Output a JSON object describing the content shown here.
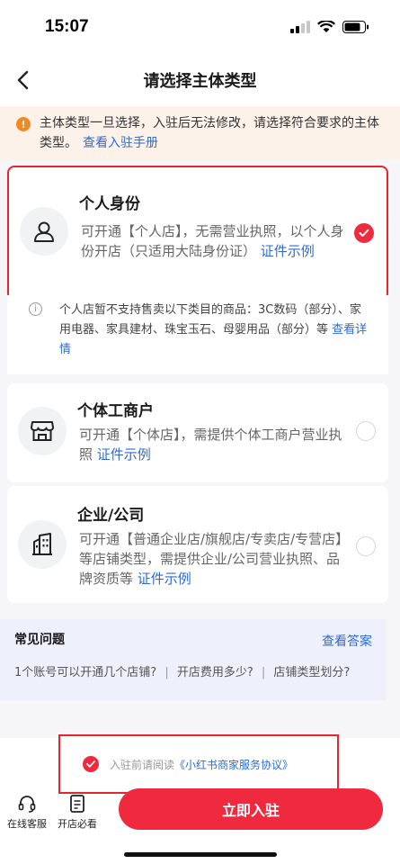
{
  "status_bar": {
    "time": "15:07"
  },
  "navbar": {
    "title": "请选择主体类型"
  },
  "notice": {
    "text": "主体类型一旦选择，入驻后无法修改，请选择符合要求的主体类型。",
    "link": "查看入驻手册"
  },
  "cards": [
    {
      "title": "个人身份",
      "desc": "可开通【个人店】，无需营业执照，以个人身份开店（只适用大陆身份证）",
      "link": "证件示例",
      "selected": true,
      "icon": "person-icon"
    },
    {
      "title": "个体工商户",
      "desc": "可开通【个体店】，需提供个体工商户营业执照",
      "link": "证件示例",
      "selected": false,
      "icon": "storefront-icon"
    },
    {
      "title": "企业/公司",
      "desc": "可开通【普通企业店/旗舰店/专卖店/专营店】等店铺类型，需提供企业/公司营业执照、品牌资质等",
      "link": "证件示例",
      "selected": false,
      "icon": "building-icon"
    }
  ],
  "personal_info": {
    "text": "个人店暂不支持售卖以下类目的商品：3C数码（部分）、家用电器、家具建材、珠宝玉石、母婴用品（部分）等",
    "link": "查看详情"
  },
  "faq": {
    "title": "常见问题",
    "link": "查看答案",
    "questions": [
      "1个账号可以开通几个店铺?",
      "开店费用多少?",
      "店铺类型划分?"
    ],
    "separator": "|"
  },
  "agreement": {
    "prefix": "入驻前请阅读",
    "link": "《小红书商家服务协议》",
    "checked": true
  },
  "bottom": {
    "tabs": [
      {
        "label": "在线客服",
        "icon": "headset-icon"
      },
      {
        "label": "开店必看",
        "icon": "document-icon"
      }
    ],
    "submit_label": "立即入驻"
  },
  "colors": {
    "accent": "#f02a3e",
    "link": "#2d6bd6",
    "notice_bg": "#fdf2ea",
    "faq_bg": "#eef0fb"
  }
}
